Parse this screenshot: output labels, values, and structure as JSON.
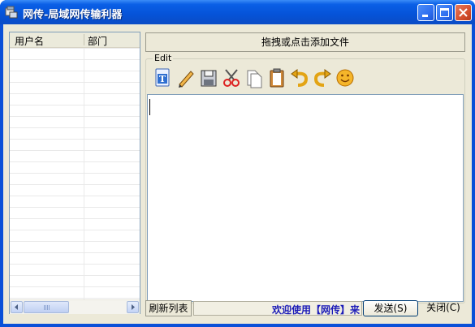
{
  "window": {
    "title": "网传-局域网传输利器"
  },
  "user_list": {
    "columns": [
      "用户名",
      "部门"
    ]
  },
  "drop_button": {
    "label": "拖拽或点击添加文件"
  },
  "edit_group": {
    "label": "Edit",
    "tools": [
      "text-format-icon",
      "pencil-icon",
      "save-icon",
      "cut-icon",
      "copy-icon",
      "paste-icon",
      "undo-icon",
      "redo-icon",
      "emoticon-icon"
    ]
  },
  "status": {
    "refresh_label": "刷新列表",
    "welcome_text": "欢迎使用【网传】",
    "welcome_cut": "来"
  },
  "buttons": {
    "send_label": "发送(S)",
    "close_label": "关闭(C)"
  },
  "colors": {
    "title_bar": "#0553d8",
    "window_bg": "#ece9d8",
    "marquee_text": "#1d1db8"
  }
}
